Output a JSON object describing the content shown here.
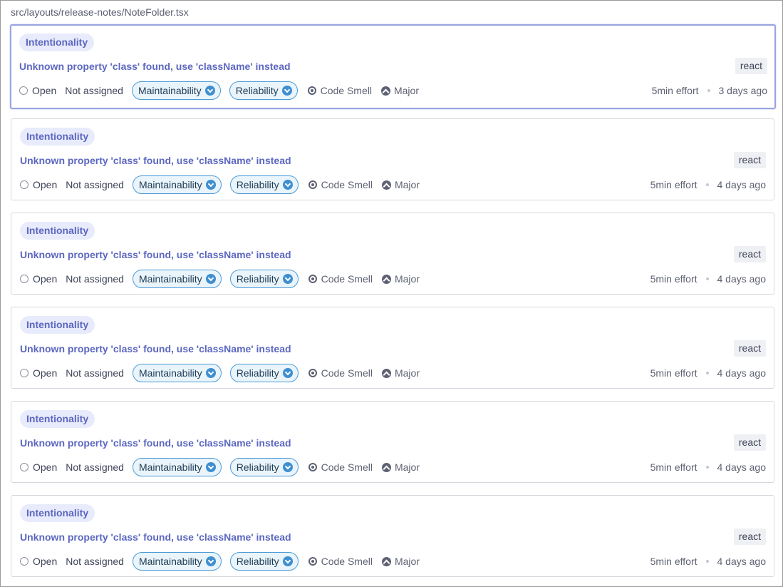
{
  "file_path": "src/layouts/release-notes/NoteFolder.tsx",
  "colors": {
    "accent": "#5c67c0",
    "quality_border": "#4c9bd6",
    "quality_bg": "#e9f4fb",
    "selected_border": "#9aa3e0"
  },
  "issues": [
    {
      "clean_code_attribute": "Intentionality",
      "message": "Unknown property 'class' found, use 'className' instead",
      "language_tag": "react",
      "status": "Open",
      "assignee": "Not assigned",
      "qualities": [
        "Maintainability",
        "Reliability"
      ],
      "type": "Code Smell",
      "severity": "Major",
      "effort": "5min effort",
      "age": "3 days ago",
      "selected": true
    },
    {
      "clean_code_attribute": "Intentionality",
      "message": "Unknown property 'class' found, use 'className' instead",
      "language_tag": "react",
      "status": "Open",
      "assignee": "Not assigned",
      "qualities": [
        "Maintainability",
        "Reliability"
      ],
      "type": "Code Smell",
      "severity": "Major",
      "effort": "5min effort",
      "age": "4 days ago",
      "selected": false
    },
    {
      "clean_code_attribute": "Intentionality",
      "message": "Unknown property 'class' found, use 'className' instead",
      "language_tag": "react",
      "status": "Open",
      "assignee": "Not assigned",
      "qualities": [
        "Maintainability",
        "Reliability"
      ],
      "type": "Code Smell",
      "severity": "Major",
      "effort": "5min effort",
      "age": "4 days ago",
      "selected": false
    },
    {
      "clean_code_attribute": "Intentionality",
      "message": "Unknown property 'class' found, use 'className' instead",
      "language_tag": "react",
      "status": "Open",
      "assignee": "Not assigned",
      "qualities": [
        "Maintainability",
        "Reliability"
      ],
      "type": "Code Smell",
      "severity": "Major",
      "effort": "5min effort",
      "age": "4 days ago",
      "selected": false
    },
    {
      "clean_code_attribute": "Intentionality",
      "message": "Unknown property 'class' found, use 'className' instead",
      "language_tag": "react",
      "status": "Open",
      "assignee": "Not assigned",
      "qualities": [
        "Maintainability",
        "Reliability"
      ],
      "type": "Code Smell",
      "severity": "Major",
      "effort": "5min effort",
      "age": "4 days ago",
      "selected": false
    },
    {
      "clean_code_attribute": "Intentionality",
      "message": "Unknown property 'class' found, use 'className' instead",
      "language_tag": "react",
      "status": "Open",
      "assignee": "Not assigned",
      "qualities": [
        "Maintainability",
        "Reliability"
      ],
      "type": "Code Smell",
      "severity": "Major",
      "effort": "5min effort",
      "age": "4 days ago",
      "selected": false
    }
  ]
}
